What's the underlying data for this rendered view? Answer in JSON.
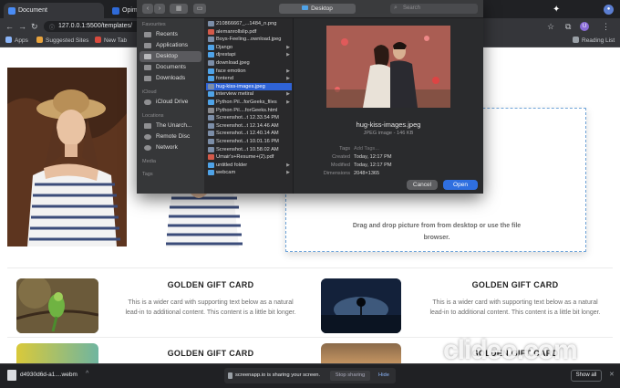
{
  "browser": {
    "tabs": [
      {
        "title": "Document",
        "active": false
      },
      {
        "title": "Opima",
        "active": false
      }
    ],
    "url": "127.0.0.1:5500/templates/",
    "bookmarks": [
      "Apps",
      "Suggested Sites",
      "New Tab"
    ],
    "reading_list": "Reading List",
    "profile_initial": "U",
    "accent": "#8ab4f8"
  },
  "dialog": {
    "location": "Desktop",
    "search_placeholder": "Search",
    "sidebar": {
      "favourites_header": "Favourites",
      "favourites": [
        "Recents",
        "Applications",
        "Desktop",
        "Documents",
        "Downloads"
      ],
      "icloud_header": "iCloud",
      "icloud": [
        "iCloud Drive"
      ],
      "locations_header": "Locations",
      "locations": [
        "The Unarch...",
        "Remote Disc",
        "Network"
      ],
      "media_header": "Media",
      "tags_header": "Tags"
    },
    "files": [
      {
        "name": "210866667_...1484_n.png",
        "type": "img",
        "folder": false
      },
      {
        "name": "alemanrollslip.pdf",
        "type": "pdf",
        "folder": false
      },
      {
        "name": "Boys-Feeling...ownload.jpeg",
        "type": "img",
        "folder": false
      },
      {
        "name": "Django",
        "type": "folder",
        "folder": true
      },
      {
        "name": "djrestapi",
        "type": "folder",
        "folder": true
      },
      {
        "name": "download.jpeg",
        "type": "img",
        "folder": false
      },
      {
        "name": "face emotion",
        "type": "folder",
        "folder": true
      },
      {
        "name": "fontend",
        "type": "folder",
        "folder": true
      },
      {
        "name": "hug-kiss-images.jpeg",
        "type": "img",
        "folder": false,
        "selected": true
      },
      {
        "name": "interview metiral",
        "type": "folder",
        "folder": true
      },
      {
        "name": "Python Pil...forGeeks_files",
        "type": "folder",
        "folder": true
      },
      {
        "name": "Python Pil....forGeeks.html",
        "type": "doc",
        "folder": false
      },
      {
        "name": "Screenshot...t 12.33.54 PM",
        "type": "img",
        "folder": false
      },
      {
        "name": "Screenshot...t 12.14.46 AM",
        "type": "img",
        "folder": false
      },
      {
        "name": "Screenshot...t 12.40.14 AM",
        "type": "img",
        "folder": false
      },
      {
        "name": "Screenshot...t 10.01.16 PM",
        "type": "img",
        "folder": false
      },
      {
        "name": "Screenshot...t 10.58.02 AM",
        "type": "img",
        "folder": false
      },
      {
        "name": "Umair's+Resume+(2).pdf",
        "type": "pdf",
        "folder": false
      },
      {
        "name": "untitled folder",
        "type": "folder",
        "folder": true
      },
      {
        "name": "webcam",
        "type": "folder",
        "folder": true
      }
    ],
    "preview": {
      "filename": "hug-kiss-images.jpeg",
      "kind": "JPEG image - 146 KB",
      "meta": [
        {
          "k": "Tags",
          "v": "Add Tags..."
        },
        {
          "k": "Created",
          "v": "Today, 12:17 PM"
        },
        {
          "k": "Modified",
          "v": "Today, 12:17 PM"
        },
        {
          "k": "Dimensions",
          "v": "2048×1365"
        }
      ]
    },
    "cancel_label": "Cancel",
    "open_label": "Open"
  },
  "page": {
    "dropzone_text": "Drag and drop picture from from desktop or use the file browser.",
    "cards": [
      {
        "title": "GOLDEN GIFT CARD",
        "text": "This is a wider card with supporting text below as a natural lead-in to additional content. This content is a little bit longer."
      },
      {
        "title": "GOLDEN GIFT CARD",
        "text": "This is a wider card with supporting text below as a natural lead-in to additional content. This content is a little bit longer."
      },
      {
        "title": "GOLDEN GIFT CARD",
        "text": ""
      },
      {
        "title": "GOLDEN GIFT CARD",
        "text": ""
      }
    ]
  },
  "bottom": {
    "download_name": "d4930d6d-a1....webm",
    "share_text": "screenapp.io is sharing your screen.",
    "stop_label": "Stop sharing",
    "hide_label": "Hide",
    "show_all": "Show all",
    "watermark": "clideo.com"
  }
}
